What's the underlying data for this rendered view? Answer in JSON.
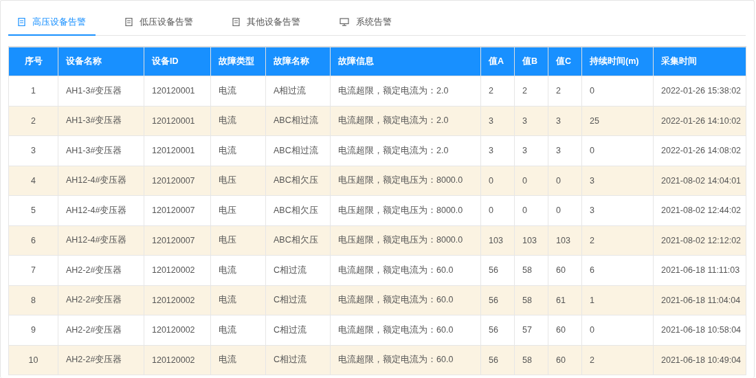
{
  "tabs": [
    {
      "label": "高压设备告警",
      "kind": "document",
      "selected": true
    },
    {
      "label": "低压设备告警",
      "kind": "document",
      "selected": false
    },
    {
      "label": "其他设备告警",
      "kind": "document",
      "selected": false
    },
    {
      "label": "系统告警",
      "kind": "monitor",
      "selected": false
    }
  ],
  "table": {
    "columns": [
      "序号",
      "设备名称",
      "设备ID",
      "故障类型",
      "故障名称",
      "故障信息",
      "值A",
      "值B",
      "值C",
      "持续时间(m)",
      "采集时间"
    ],
    "rows": [
      [
        "1",
        "AH1-3#变压器",
        "120120001",
        "电流",
        "A相过流",
        "电流超限，额定电流为：2.0",
        "2",
        "2",
        "2",
        "0",
        "2022-01-26 15:38:02"
      ],
      [
        "2",
        "AH1-3#变压器",
        "120120001",
        "电流",
        "ABC相过流",
        "电流超限，额定电流为：2.0",
        "3",
        "3",
        "3",
        "25",
        "2022-01-26 14:10:02"
      ],
      [
        "3",
        "AH1-3#变压器",
        "120120001",
        "电流",
        "ABC相过流",
        "电流超限，额定电流为：2.0",
        "3",
        "3",
        "3",
        "0",
        "2022-01-26 14:08:02"
      ],
      [
        "4",
        "AH12-4#变压器",
        "120120007",
        "电压",
        "ABC相欠压",
        "电压超限，额定电压为：8000.0",
        "0",
        "0",
        "0",
        "3",
        "2021-08-02 14:04:01"
      ],
      [
        "5",
        "AH12-4#变压器",
        "120120007",
        "电压",
        "ABC相欠压",
        "电压超限，额定电压为：8000.0",
        "0",
        "0",
        "0",
        "3",
        "2021-08-02 12:44:02"
      ],
      [
        "6",
        "AH12-4#变压器",
        "120120007",
        "电压",
        "ABC相欠压",
        "电压超限，额定电压为：8000.0",
        "103",
        "103",
        "103",
        "2",
        "2021-08-02 12:12:02"
      ],
      [
        "7",
        "AH2-2#变压器",
        "120120002",
        "电流",
        "C相过流",
        "电流超限，额定电流为：60.0",
        "56",
        "58",
        "60",
        "6",
        "2021-06-18 11:11:03"
      ],
      [
        "8",
        "AH2-2#变压器",
        "120120002",
        "电流",
        "C相过流",
        "电流超限，额定电流为：60.0",
        "56",
        "58",
        "61",
        "1",
        "2021-06-18 11:04:04"
      ],
      [
        "9",
        "AH2-2#变压器",
        "120120002",
        "电流",
        "C相过流",
        "电流超限，额定电流为：60.0",
        "56",
        "57",
        "60",
        "0",
        "2021-06-18 10:58:04"
      ],
      [
        "10",
        "AH2-2#变压器",
        "120120002",
        "电流",
        "C相过流",
        "电流超限，额定电流为：60.0",
        "56",
        "58",
        "60",
        "2",
        "2021-06-18 10:49:04"
      ]
    ]
  }
}
